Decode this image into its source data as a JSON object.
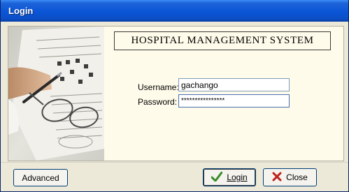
{
  "window": {
    "title": "Login"
  },
  "header": {
    "title": "HOSPITAL MANAGEMENT SYSTEM"
  },
  "form": {
    "username_label": "Username:",
    "username_value": "gachango",
    "password_label": "Password:",
    "password_value": "****************"
  },
  "buttons": {
    "advanced": "Advanced",
    "login": "Login",
    "close": "Close"
  },
  "icons": {
    "login": "checkmark-icon",
    "close": "x-icon"
  },
  "colors": {
    "titlebar": "#0a55d6",
    "panel": "#fffbea",
    "window": "#ece9d8",
    "login_check": "#3a8a2a",
    "close_x": "#c0201a"
  }
}
